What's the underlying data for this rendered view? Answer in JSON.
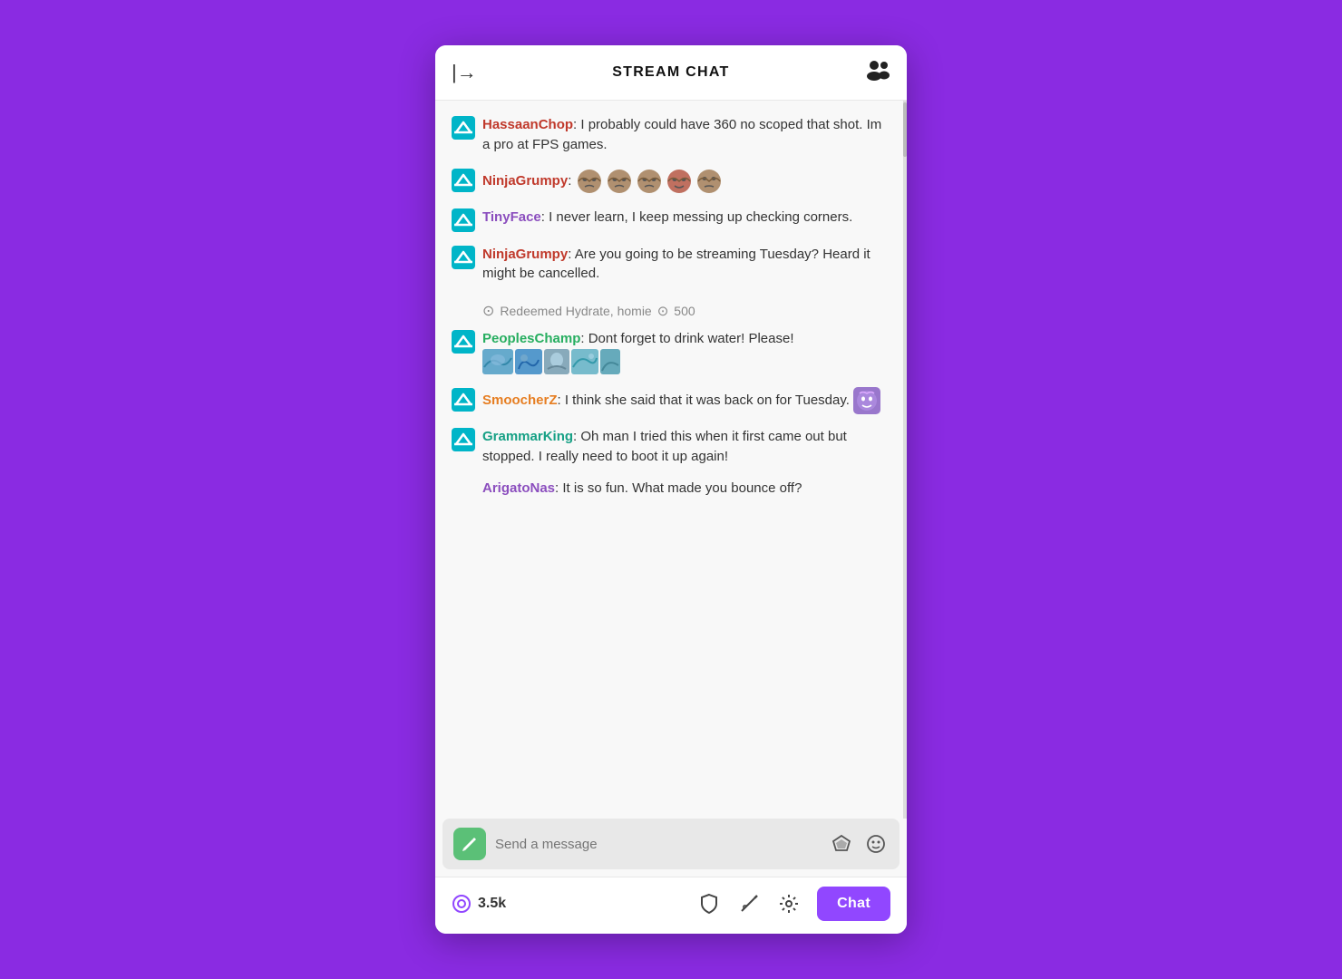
{
  "header": {
    "title": "STREAM CHAT",
    "arrow_label": "|→",
    "users_icon": "👥"
  },
  "messages": [
    {
      "id": "msg1",
      "username": "HassaanChop",
      "username_color": "red",
      "has_badge": true,
      "text": ": I probably could have 360 no scoped that shot. Im a pro at FPS games.",
      "has_emotes": false,
      "emote_type": null
    },
    {
      "id": "msg2",
      "username": "NinjaGrumpy",
      "username_color": "red",
      "has_badge": true,
      "text": ":",
      "has_emotes": true,
      "emote_type": "faces",
      "emote_count": 5
    },
    {
      "id": "msg3",
      "username": "TinyFace",
      "username_color": "purple",
      "has_badge": true,
      "text": ": I never learn, I keep messing up checking corners.",
      "has_emotes": false
    },
    {
      "id": "msg4",
      "username": "NinjaGrumpy",
      "username_color": "red",
      "has_badge": true,
      "text": ": Are you going to be streaming Tuesday? Heard it might be cancelled.",
      "has_emotes": false
    },
    {
      "id": "msg5_redeemed",
      "type": "redeemed",
      "text": "Redeemed Hydrate, homie",
      "points": "500"
    },
    {
      "id": "msg5",
      "username": "PeoplesChamp",
      "username_color": "green",
      "has_badge": true,
      "text": ": Dont forget to drink water! Please!",
      "has_emotes": true,
      "emote_type": "water"
    },
    {
      "id": "msg6",
      "username": "SmoocherZ",
      "username_color": "orange",
      "has_badge": true,
      "text": ": I think she said that it was back on for Tuesday.",
      "has_emotes": true,
      "emote_type": "purple_face"
    },
    {
      "id": "msg7",
      "username": "GrammarKing",
      "username_color": "teal",
      "has_badge": true,
      "text": ": Oh man I tried this when it first came out but stopped. I really need to boot it up again!",
      "has_emotes": false
    },
    {
      "id": "msg8",
      "username": "ArigatoNas",
      "username_color": "purple",
      "has_badge": false,
      "text": ": It is so fun. What made you bounce off?",
      "has_emotes": false
    }
  ],
  "input": {
    "placeholder": "Send a message"
  },
  "bottom": {
    "viewer_count": "3.5k",
    "chat_button_label": "Chat"
  }
}
